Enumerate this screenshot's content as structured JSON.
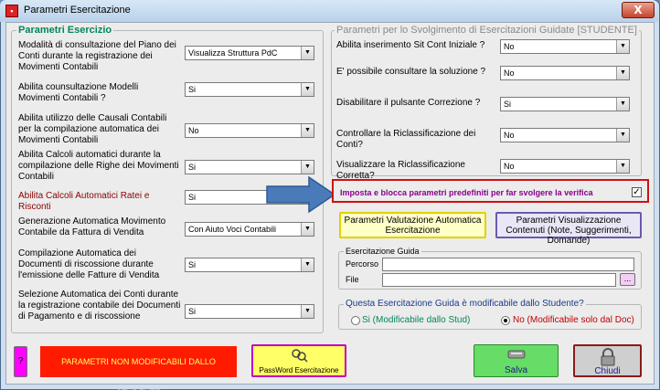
{
  "window": {
    "title": "Parametri Esercitazione",
    "close_glyph": "X"
  },
  "left_panel": {
    "legend": "Parametri Esercizio",
    "rows": [
      {
        "label": "Modalità di consultazione del Piano dei Conti durante la registrazione dei Movimenti Contabili",
        "value": "Visualizza Struttura PdC"
      },
      {
        "label": "Abilita counsultazione Modelli Movimenti Contabili ?",
        "value": "Si"
      },
      {
        "label": "Abilita utilizzo delle Causali Contabili per la compilazione automatica dei Movimenti Contabili",
        "value": "No"
      },
      {
        "label": "Abilita Calcoli automatici durante la compilazione delle Righe dei Movimenti Contabili",
        "value": "Si"
      },
      {
        "label": "Abilita Calcoli Automatici Ratei e Risconti",
        "value": "Si"
      },
      {
        "label": "Generazione Automatica Movimento Contabile da Fattura di Vendita",
        "value": "Con Aiuto Voci Contabili"
      },
      {
        "label": "Compilazione Automatica dei Documenti di riscossione durante l'emissione delle Fatture di Vendita",
        "value": "Si"
      },
      {
        "label": "Selezione Automatica dei Conti durante la registrazione contabile dei Documenti di Pagamento e di riscossione",
        "value": "Si"
      }
    ]
  },
  "right_panel": {
    "legend": "Parametri per lo Svolgimento di Esercitazioni Guidate [STUDENTE]",
    "rows": [
      {
        "label": "Abilita inserimento Sit Cont Iniziale ?",
        "value": "No"
      },
      {
        "label": "E' possibile consultare la soluzione ?",
        "value": "No"
      },
      {
        "label": "Disabilitare il pulsante Correzione ?",
        "value": "Si"
      },
      {
        "label": "Controllare la Riclassificazione dei Conti?",
        "value": "No"
      },
      {
        "label": "Visualizzare la Riclassificazione Corretta?",
        "value": "No"
      }
    ],
    "lock_checkbox_label": "Imposta e blocca parametri predefiniti per far svolgere la verifica",
    "lock_checked_glyph": "✓",
    "btn_valutazione": "Parametri Valutazione Automatica Esercitazione",
    "btn_visualizzazione": "Parametri Visualizzazione Contenuti (Note, Suggerimenti, Domande)",
    "guida": {
      "legend": "Esercitazione Guida",
      "percorso_label": "Percorso",
      "file_label": "File",
      "browse_label": "..."
    },
    "modificabile": {
      "legend": "Questa Esercitazione Guida è modificabile dallo Studente?",
      "option_si": "Si (Modificabile dallo Stud)",
      "option_no": "No  (Modificabile solo dal Doc)",
      "selected": "no"
    }
  },
  "footer": {
    "help_label": "?",
    "warning_text": "PARAMETRI NON MODIFICABILI DALLO STUDENTE",
    "password_label": "PassWord Esercitazione",
    "save_label": "Salva",
    "close_label": "Chiudi"
  },
  "colors": {
    "accent_green": "#00875a",
    "warning_red": "#ff1a00",
    "highlight_border": "#d01010",
    "arrow_blue": "#4a7ab8",
    "magenta": "#ff00ff",
    "yellow": "#ffff66",
    "green_button": "#66dd66"
  }
}
